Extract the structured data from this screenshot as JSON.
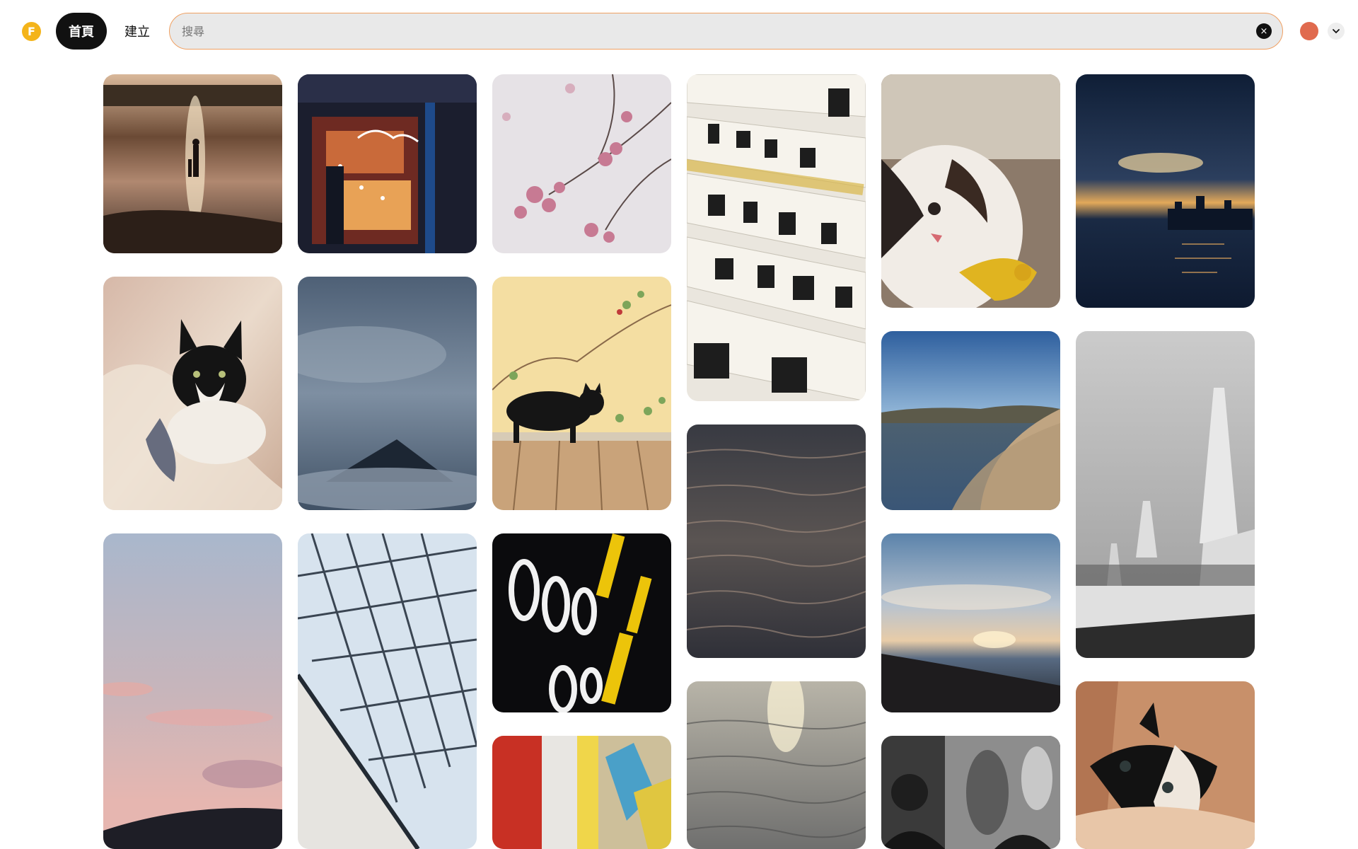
{
  "header": {
    "logo_letter": "F",
    "nav_home": "首頁",
    "nav_create": "建立",
    "search_placeholder": "搜尋",
    "clear_icon": "×"
  },
  "colors": {
    "accent_border": "#f0a062",
    "avatar": "#e06a4e",
    "logo": "#f4b41a"
  },
  "pins": [
    {
      "name": "pin-beach-sunset-family",
      "desc": "beach-sunset-family"
    },
    {
      "name": "pin-neon-cafe-night",
      "desc": "neon-cafe-night"
    },
    {
      "name": "pin-pink-blossoms",
      "desc": "pink-blossoms"
    },
    {
      "name": "pin-chinese-calligraphy-fan",
      "desc": "chinese-calligraphy-fan"
    },
    {
      "name": "pin-kitten-yellow-collar",
      "desc": "kitten-yellow-collar"
    },
    {
      "name": "pin-dusk-city-skyline-water",
      "desc": "dusk-city-skyline-water"
    },
    {
      "name": "pin-cat-on-blanket",
      "desc": "cat-on-blanket"
    },
    {
      "name": "pin-misty-mountain",
      "desc": "misty-mountain"
    },
    {
      "name": "pin-black-cat-on-deck",
      "desc": "black-cat-on-deck"
    },
    {
      "name": "pin-lake-shore-town",
      "desc": "lake-shore-town"
    },
    {
      "name": "pin-white-stupas",
      "desc": "white-stupas"
    },
    {
      "name": "pin-dark-water-ripples",
      "desc": "dark-water-ripples"
    },
    {
      "name": "pin-pink-sky-hills",
      "desc": "pink-sky-hills"
    },
    {
      "name": "pin-glass-roof-grid",
      "desc": "glass-roof-grid"
    },
    {
      "name": "pin-neon-signs-bokeh",
      "desc": "neon-signs-bokeh"
    },
    {
      "name": "pin-beach-sunset-clouds",
      "desc": "beach-sunset-clouds"
    },
    {
      "name": "pin-prayer-flags-red",
      "desc": "prayer-flags-red"
    },
    {
      "name": "pin-sunlit-water",
      "desc": "sunlit-water"
    },
    {
      "name": "pin-bw-temple-mural",
      "desc": "bw-temple-mural"
    },
    {
      "name": "pin-cat-peeking",
      "desc": "cat-peeking"
    }
  ]
}
